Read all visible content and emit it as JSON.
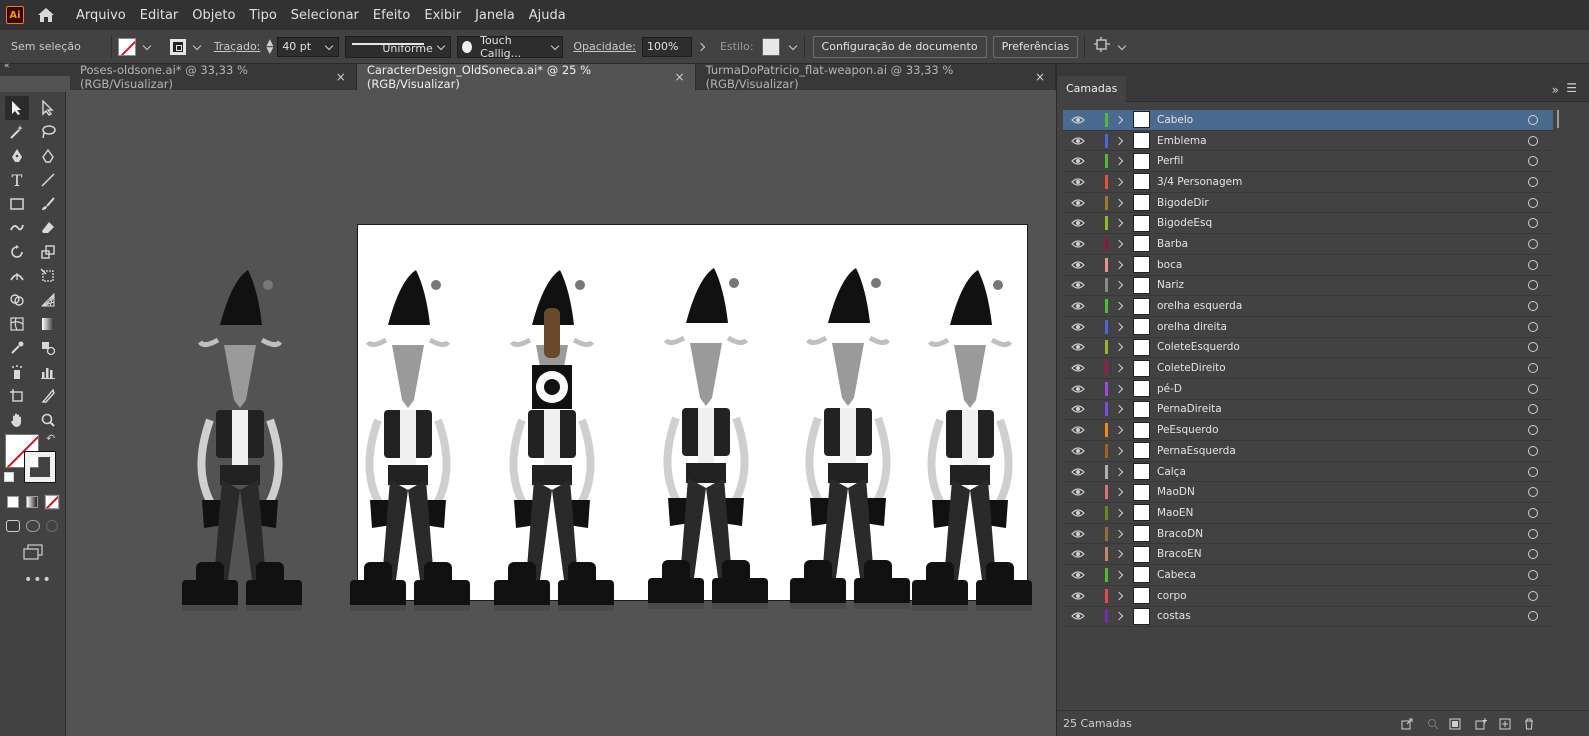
{
  "app": {
    "logo_text": "Ai"
  },
  "menu": [
    "Arquivo",
    "Editar",
    "Objeto",
    "Tipo",
    "Selecionar",
    "Efeito",
    "Exibir",
    "Janela",
    "Ajuda"
  ],
  "control": {
    "selection_status": "Sem seleção",
    "stroke_label": "Traçado:",
    "stroke_weight": "40 pt",
    "profile_label": "Uniforme",
    "brush_label": "Touch Callig...",
    "opacity_label": "Opacidade:",
    "opacity_value": "100%",
    "style_label": "Estilo:",
    "doc_setup_button": "Configuração de documento",
    "preferences_button": "Preferências"
  },
  "tabs": [
    {
      "label": "Poses-oldsone.ai* @ 33,33 % (RGB/Visualizar)",
      "active": false
    },
    {
      "label": "CaracterDesign_OldSoneca.ai* @ 25 % (RGB/Visualizar)",
      "active": true
    },
    {
      "label": "TurmaDoPatricio_flat-weapon.ai @ 33,33 % (RGB/Visualizar)",
      "active": false
    }
  ],
  "layers_panel": {
    "title": "Camadas",
    "count_label": "25 Camadas",
    "layers": [
      {
        "name": "Cabelo",
        "color": "#4dbd33",
        "selected": true
      },
      {
        "name": "Emblema",
        "color": "#4e65d8"
      },
      {
        "name": "Perfil",
        "color": "#4dbd33"
      },
      {
        "name": "3/4 Personagem",
        "color": "#e8513a"
      },
      {
        "name": "BigodeDir",
        "color": "#a0782d"
      },
      {
        "name": "BigodeEsq",
        "color": "#9ab524"
      },
      {
        "name": "Barba",
        "color": "#8a1a3a"
      },
      {
        "name": "boca",
        "color": "#e8908a"
      },
      {
        "name": "Nariz",
        "color": "#8a8a8a"
      },
      {
        "name": "orelha esquerda",
        "color": "#4dbd33"
      },
      {
        "name": "orelha direita",
        "color": "#4e65d8"
      },
      {
        "name": "ColeteEsquerdo",
        "color": "#9ab524"
      },
      {
        "name": "ColeteDireito",
        "color": "#a02042"
      },
      {
        "name": "pé-D",
        "color": "#9b4be0"
      },
      {
        "name": "PernaDireita",
        "color": "#7a4be0"
      },
      {
        "name": "PeEsquerdo",
        "color": "#f08a1a"
      },
      {
        "name": "PernaEsquerda",
        "color": "#a0621e"
      },
      {
        "name": "Calça",
        "color": "#b0b0b0"
      },
      {
        "name": "MaoDN",
        "color": "#e07070"
      },
      {
        "name": "MaoEN",
        "color": "#6a8a1a"
      },
      {
        "name": "BracoDN",
        "color": "#9a6a3a"
      },
      {
        "name": "BracoEN",
        "color": "#c08a6a"
      },
      {
        "name": "Cabeca",
        "color": "#4dbd33"
      },
      {
        "name": "corpo",
        "color": "#e84a4a"
      },
      {
        "name": "costas",
        "color": "#7a2aa8"
      }
    ]
  }
}
